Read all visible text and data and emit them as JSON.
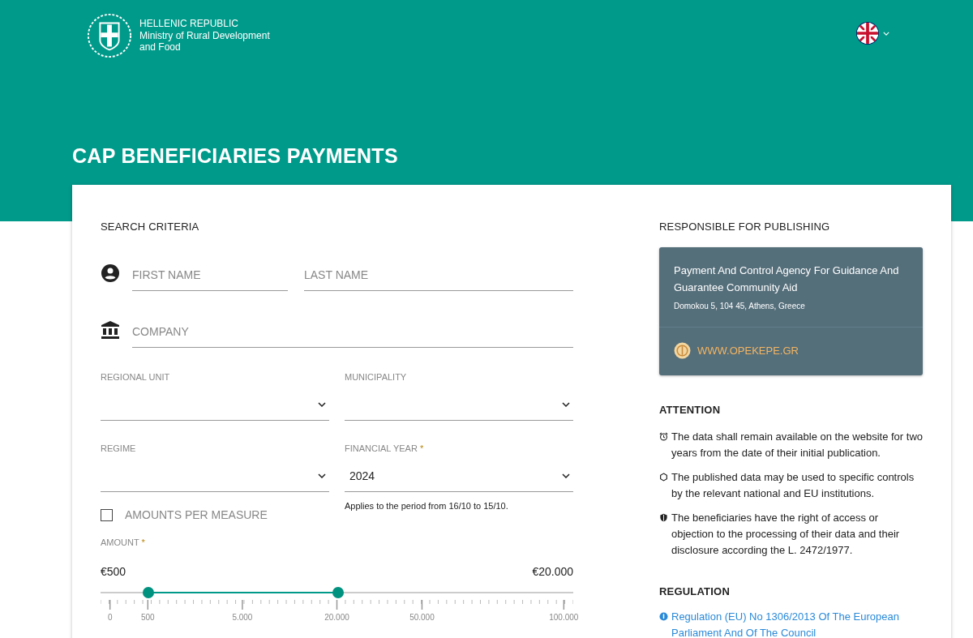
{
  "header": {
    "org_lines": [
      "HELLENIC REPUBLIC",
      "Ministry of Rural Development",
      "and Food"
    ]
  },
  "page_title": "CAP BENEFICIARIES PAYMENTS",
  "search": {
    "heading": "SEARCH CRITERIA",
    "name_fields": [
      {
        "placeholder": "FIRST NAME"
      },
      {
        "placeholder": "LAST NAME"
      }
    ],
    "company_field": {
      "placeholder": "COMPANY"
    },
    "selects": [
      {
        "label": "REGIONAL UNIT"
      },
      {
        "label": "MUNICIPALITY"
      },
      {
        "label": "REGIME"
      },
      {
        "label": "FINANCIAL YEAR",
        "required_mark": "*",
        "value": "2024",
        "hint": "Applies to the period from 16/10 to 15/10."
      }
    ],
    "checkbox": {
      "label": "AMOUNTS PER MEASURE",
      "checked": false
    },
    "amount": {
      "label": "AMOUNT",
      "required_mark": "*",
      "min_reading": "€500",
      "max_reading": "€20.000",
      "thumbs": [
        {
          "level": 0.101
        },
        {
          "level": 0.503
        }
      ],
      "tick_labels": [
        "0",
        "500",
        "5.000",
        "20.000",
        "50.000",
        "100.000"
      ]
    }
  },
  "publisher": {
    "heading": "RESPONSIBLE FOR PUBLISHING",
    "name": "Payment And Control Agency For Guidance And Guarantee Community Aid",
    "address": "Domokou 5, 104 45, Athens, Greece",
    "website": "WWW.OPEKEPE.GR"
  },
  "attention": {
    "heading": "ATTENTION",
    "items": [
      {
        "kind": "clock",
        "text": "The data shall remain available on the website for two years from the date of their initial publication."
      },
      {
        "kind": "circle",
        "text": "The published data may be used to specific controls by the relevant national and EU institutions."
      },
      {
        "kind": "shield",
        "text": "The beneficiaries have the right of access or objection to the processing of their data and their disclosure according the L. 2472/1977."
      }
    ]
  },
  "regulation": {
    "heading": "REGULATION",
    "link": "Regulation (EU) No 1306/2013 Of The European Parliament And Of The Council"
  }
}
